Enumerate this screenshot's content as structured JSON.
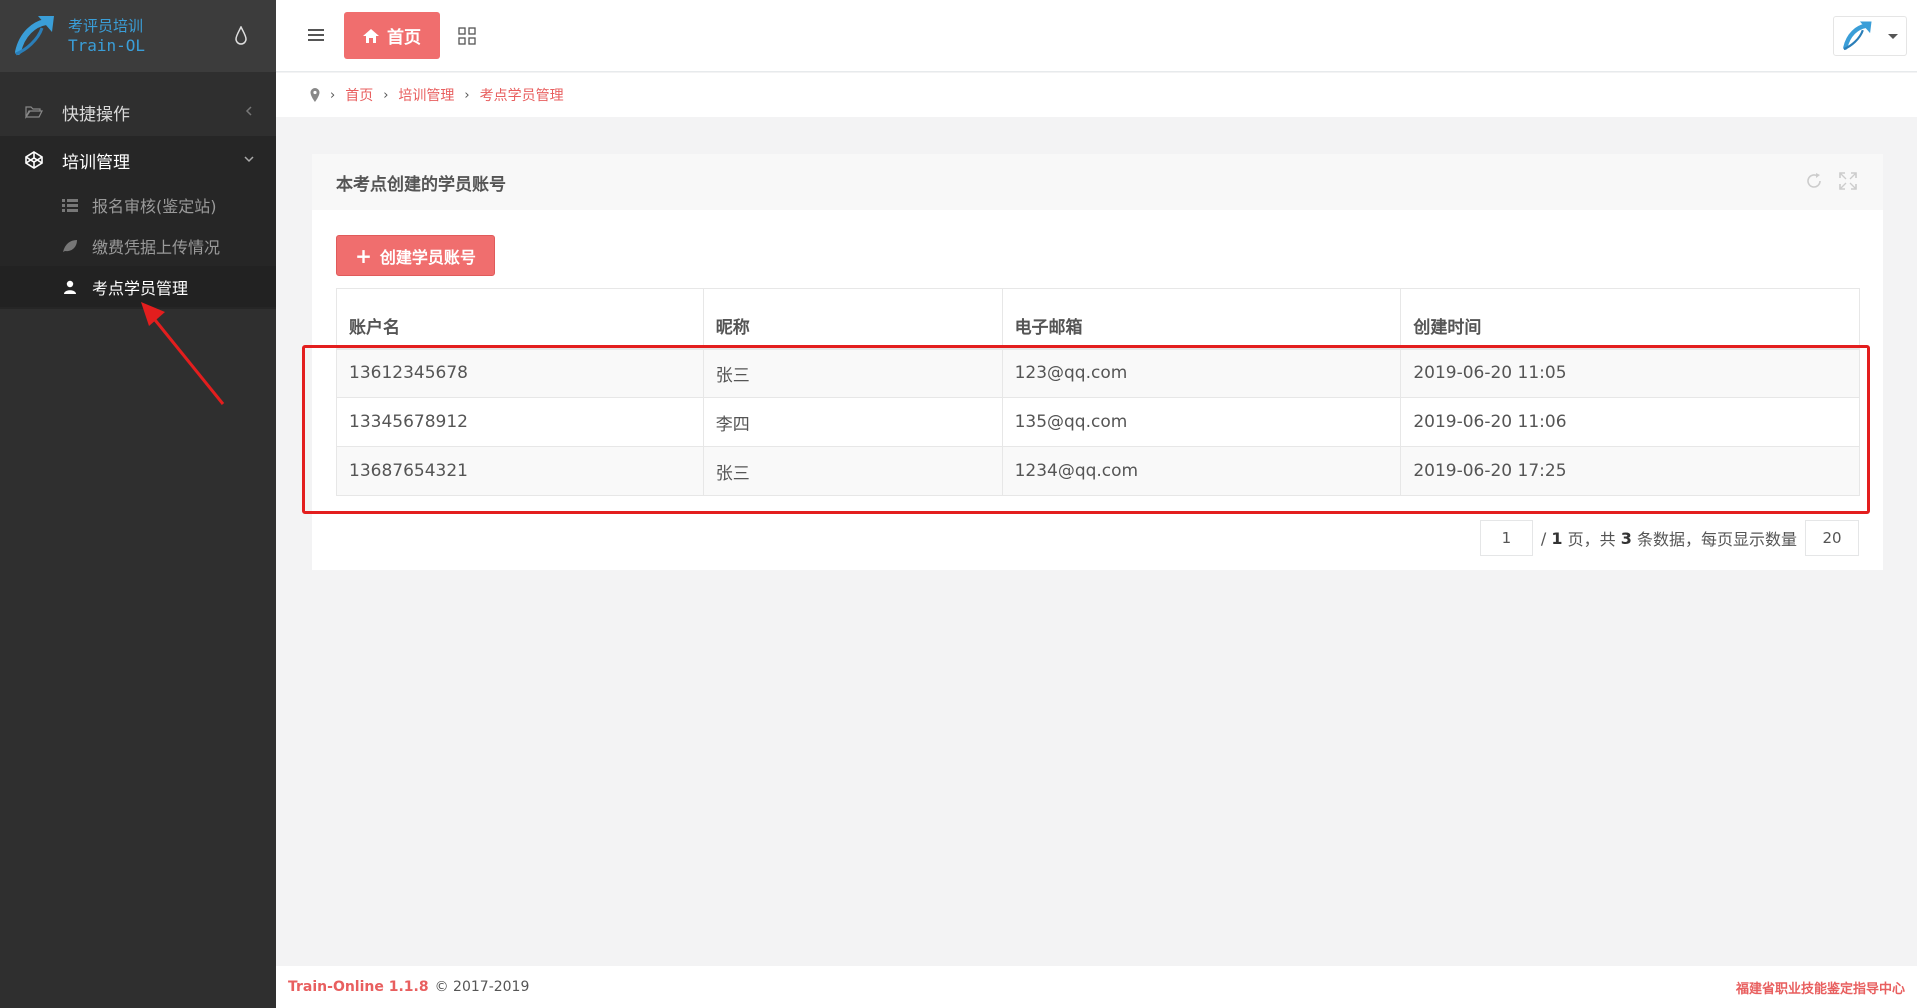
{
  "sidebar": {
    "logo_cn": "考评员培训",
    "logo_en": "Train-OL",
    "menu": [
      {
        "label": "快捷操作",
        "icon": "folder-open-icon",
        "expanded": false
      },
      {
        "label": "培训管理",
        "icon": "codepen-icon",
        "expanded": true
      }
    ],
    "submenu": [
      {
        "label": "报名审核(鉴定站)",
        "icon": "list-icon"
      },
      {
        "label": "缴费凭据上传情况",
        "icon": "leaf-icon"
      },
      {
        "label": "考点学员管理",
        "icon": "user-icon",
        "active": true
      }
    ]
  },
  "topbar": {
    "home_label": "首页"
  },
  "breadcrumb": [
    "首页",
    "培训管理",
    "考点学员管理"
  ],
  "panel": {
    "title": "本考点创建的学员账号",
    "create_label": "创建学员账号"
  },
  "table": {
    "headers": [
      "账户名",
      "昵称",
      "电子邮箱",
      "创建时间"
    ],
    "rows": [
      [
        "13612345678",
        "张三",
        "123@qq.com",
        "2019-06-20 11:05"
      ],
      [
        "13345678912",
        "李四",
        "135@qq.com",
        "2019-06-20 11:06"
      ],
      [
        "13687654321",
        "张三",
        "1234@qq.com",
        "2019-06-20 17:25"
      ]
    ]
  },
  "pager": {
    "current_page": "1",
    "total_pages": "1",
    "total_items": "3",
    "page_size": "20",
    "text_sep": "/",
    "text_page": "页，共",
    "text_items": "条数据，每页显示数量"
  },
  "footer": {
    "brand": "Train-Online 1.1.8",
    "copyright": "© 2017-2019",
    "org": "福建省职业技能鉴定指导中心"
  },
  "colors": {
    "accent": "#f06e6e",
    "sidebar_bg": "#2f2f2f",
    "highlight": "#e31e1e",
    "logo": "#3a9ed8"
  }
}
